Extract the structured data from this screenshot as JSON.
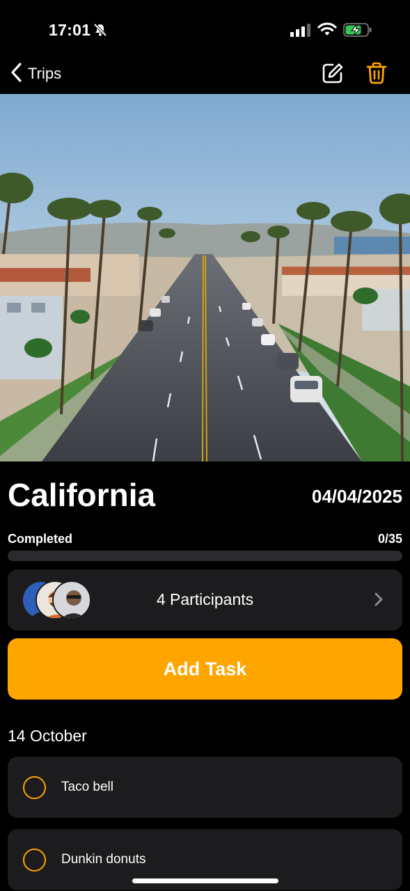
{
  "status_bar": {
    "time": "17:01"
  },
  "nav": {
    "back_label": "Trips"
  },
  "trip": {
    "title": "California",
    "date": "04/04/2025",
    "progress_label": "Completed",
    "progress_count": "0/35",
    "progress_fraction": 0
  },
  "participants": {
    "label": "4 Participants"
  },
  "add_task": {
    "label": "Add Task"
  },
  "tasks_section": {
    "date": "14 October",
    "items": [
      {
        "label": "Taco bell"
      },
      {
        "label": "Dunkin donuts"
      }
    ]
  },
  "colors": {
    "accent": "#FFA500",
    "card": "#1c1c1e",
    "background": "#000000"
  }
}
